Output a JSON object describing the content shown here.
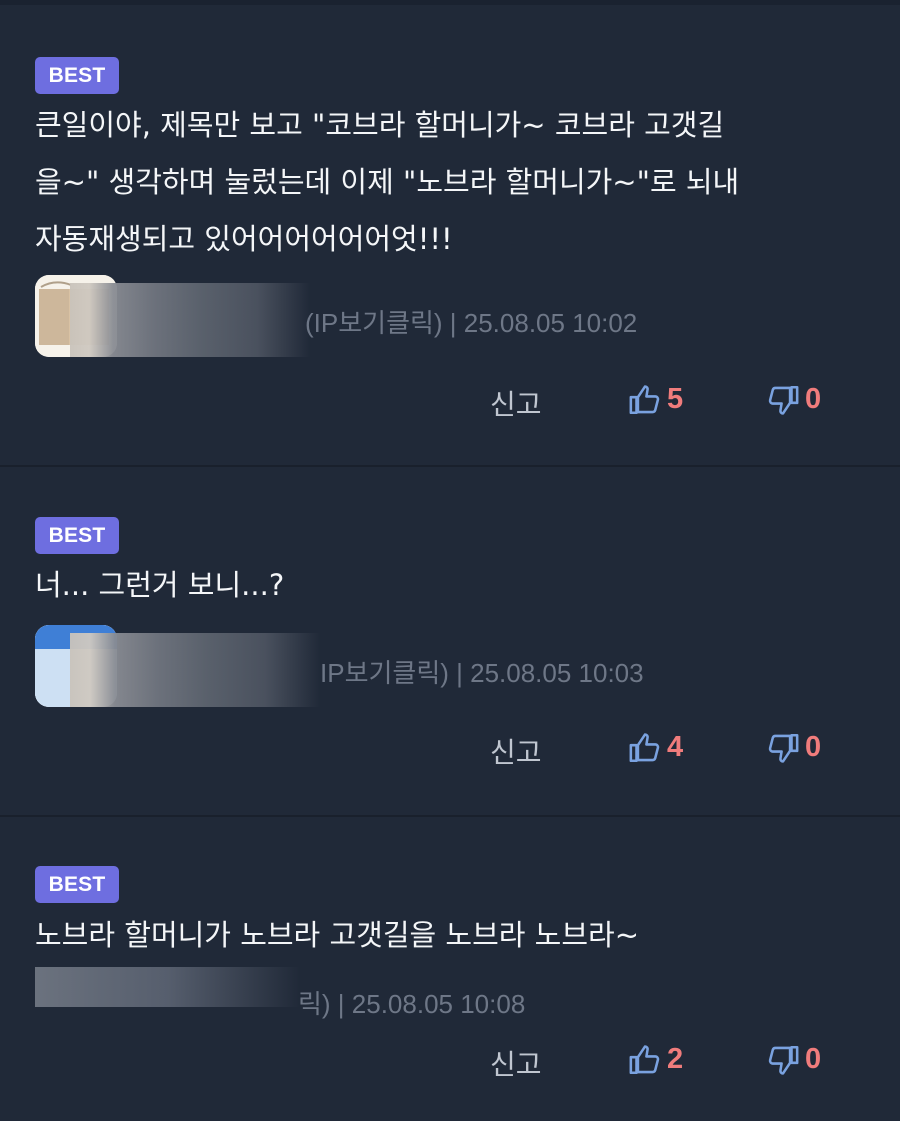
{
  "comments": [
    {
      "badge": "BEST",
      "text": "큰일이야, 제목만 보고 \"코브라 할머니가~ 코브라 고갯길\n을~\" 생각하며 눌렀는데 이제 \"노브라 할머니가~\"로 뇌내\n자동재생되고 있어어어어어어엇!!!",
      "meta": "(IP보기클릭) | 25.08.05 10:02",
      "report_label": "신고",
      "likes": "5",
      "dislikes": "0",
      "avatar_icon": "user-avatar-image"
    },
    {
      "badge": "BEST",
      "text": "너... 그런거 보니...?",
      "meta": "IP보기클릭) | 25.08.05 10:03",
      "report_label": "신고",
      "likes": "4",
      "dislikes": "0",
      "avatar_icon": "user-avatar-image"
    },
    {
      "badge": "BEST",
      "text": "노브라 할머니가 노브라 고갯길을 노브라 노브라~",
      "meta": "릭) | 25.08.05 10:08",
      "report_label": "신고",
      "likes": "2",
      "dislikes": "0"
    }
  ],
  "icons": {
    "like": "thumbs-up-icon",
    "dislike": "thumbs-down-icon"
  },
  "colors": {
    "background": "#202938",
    "badge": "#6e6ee0",
    "count": "#f07c7c",
    "icon": "#7aa2e0",
    "meta": "#6e7787"
  }
}
